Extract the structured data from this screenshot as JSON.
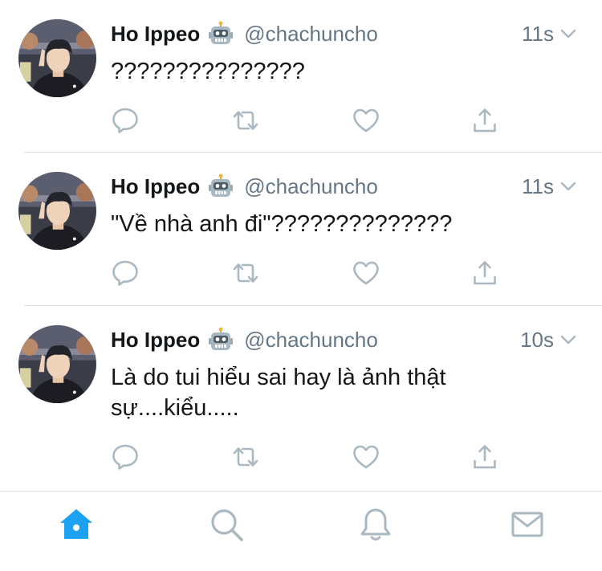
{
  "tweets": [
    {
      "name": "Ho Ippeo",
      "handle": "@chachuncho",
      "time": "11s",
      "text": "???????????????"
    },
    {
      "name": "Ho Ippeo",
      "handle": "@chachuncho",
      "time": "11s",
      "text": "\"Về nhà anh đi\"??????????????"
    },
    {
      "name": "Ho Ippeo",
      "handle": "@chachuncho",
      "time": "10s",
      "text": "Là do tui hiểu sai hay là ảnh thật sự....kiểu....."
    }
  ],
  "icons": {
    "badge": "robot-emoji-icon",
    "menu": "chevron-down-icon",
    "actions": [
      "reply-icon",
      "retweet-icon",
      "like-icon",
      "share-icon"
    ],
    "tabs": [
      "home-icon",
      "search-icon",
      "notifications-icon",
      "messages-icon"
    ]
  },
  "colors": {
    "accent": "#1da1f2",
    "secondary_text": "#657786",
    "icon_gray": "#aab8c2",
    "divider": "#dcdfe3"
  },
  "tabbar": {
    "active_tab": "home"
  }
}
